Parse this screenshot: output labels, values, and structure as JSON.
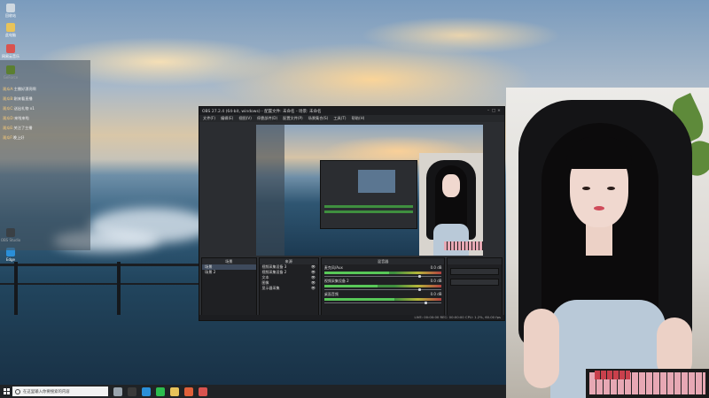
{
  "desktop": {
    "icons": [
      {
        "label": "回收站",
        "name": "recycle-bin-icon",
        "color": "#cfd8e0"
      },
      {
        "label": "此电脑",
        "name": "computer-icon",
        "color": "#e8c35a"
      },
      {
        "label": "网易云音乐",
        "name": "music-app-icon",
        "color": "#d9534f"
      },
      {
        "label": "GeForce",
        "name": "geforce-icon",
        "color": "#76b900"
      },
      {
        "label": "OBS Studio",
        "name": "obs-icon",
        "color": "#2d2d2d"
      },
      {
        "label": "Edge",
        "name": "edge-icon",
        "color": "#2a8fd8"
      }
    ]
  },
  "chat": {
    "lines": [
      {
        "name": "观众A:",
        "text": "主播好漂亮啊"
      },
      {
        "name": "观众B:",
        "text": "刚来看直播"
      },
      {
        "name": "观众C:",
        "text": "送出礼物 x1"
      },
      {
        "name": "观众D:",
        "text": "来啦来啦"
      },
      {
        "name": "观众E:",
        "text": "关注了主播"
      },
      {
        "name": "观众F:",
        "text": "晚上好"
      }
    ]
  },
  "obs": {
    "title": "OBS 27.2.4 (64-bit, windows) - 配置文件: 未命名 - 场景: 未命名",
    "menu": [
      "文件(F)",
      "编辑(E)",
      "视图(V)",
      "停靠部件(D)",
      "配置文件(P)",
      "场景集合(S)",
      "工具(T)",
      "帮助(H)"
    ],
    "panels": {
      "scenes": "场景",
      "sources": "来源",
      "mixer": "混音器"
    },
    "scene_items": [
      "场景",
      "场景 2"
    ],
    "source_items": [
      "视频采集设备 3",
      "视频采集设备 2",
      "文本",
      "图像",
      "显示器采集"
    ],
    "mixer_tracks": [
      {
        "name": "麦克风/Aux",
        "db": "0.0 dB",
        "level": 0.55,
        "volume": 0.8
      },
      {
        "name": "视频采集设备 2",
        "db": "0.0 dB",
        "level": 0.45,
        "volume": 0.8
      },
      {
        "name": "桌面音频",
        "db": "0.0 dB",
        "level": 0.6,
        "volume": 0.85
      }
    ],
    "status": "LIVE: 00:00:00   REC: 00:00:00   CPU: 1.2%, 60.00 fps"
  },
  "taskbar": {
    "search_placeholder": "在这里输入你要搜索的内容",
    "apps": [
      {
        "name": "task-view-icon",
        "color": "#9aa4ad"
      },
      {
        "name": "obs-taskbar-icon",
        "color": "#3a3a3a"
      },
      {
        "name": "edge-taskbar-icon",
        "color": "#2a8fd8"
      },
      {
        "name": "wechat-taskbar-icon",
        "color": "#2dbd4e"
      },
      {
        "name": "folder-taskbar-icon",
        "color": "#e8c35a"
      },
      {
        "name": "app-taskbar-icon",
        "color": "#e0603a"
      },
      {
        "name": "media-taskbar-icon",
        "color": "#d9534f"
      }
    ]
  }
}
